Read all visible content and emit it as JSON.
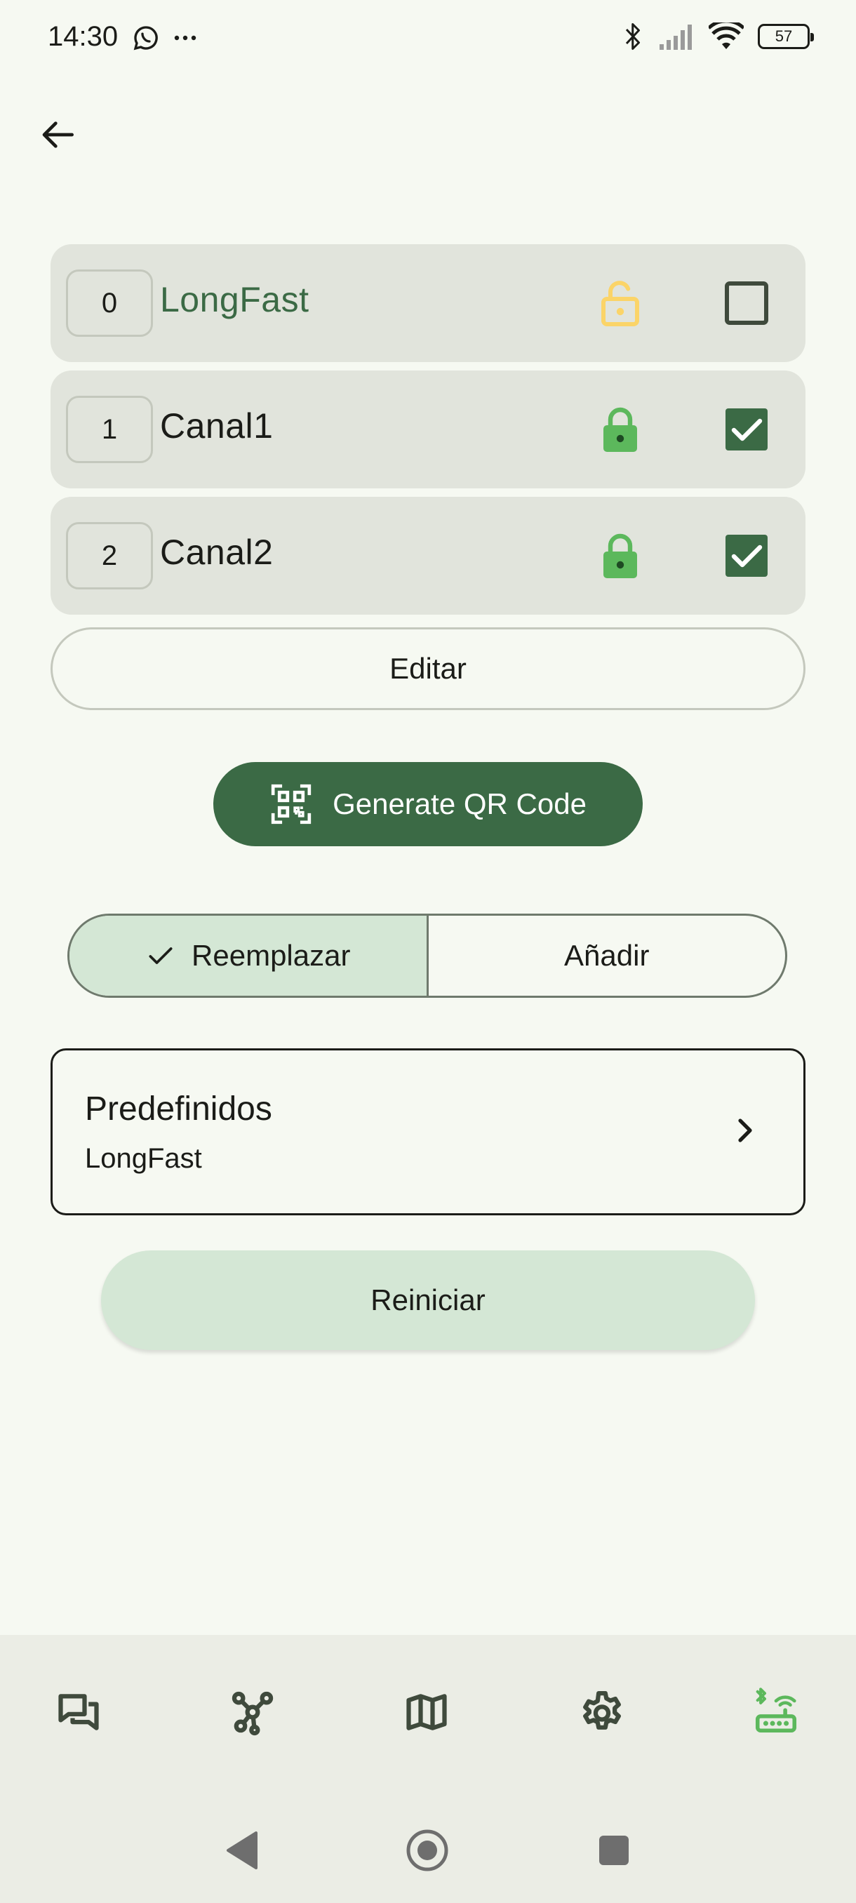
{
  "status_bar": {
    "time": "14:30",
    "battery": "57",
    "icons": [
      "whatsapp-icon",
      "more-dots-icon",
      "bluetooth-icon",
      "signal-icon",
      "wifi-icon",
      "battery-icon"
    ]
  },
  "channels": [
    {
      "index": "0",
      "name": "LongFast",
      "lock": "unlocked",
      "checked": false,
      "name_color": "#3b6a45",
      "lock_color": "#fbd468"
    },
    {
      "index": "1",
      "name": "Canal1",
      "lock": "locked",
      "checked": true,
      "name_color": "#1b1c18",
      "lock_color": "#5cb85c"
    },
    {
      "index": "2",
      "name": "Canal2",
      "lock": "locked",
      "checked": true,
      "name_color": "#1b1c18",
      "lock_color": "#5cb85c"
    }
  ],
  "edit_label": "Editar",
  "qr_label": "Generate QR Code",
  "mode": {
    "replace_label": "Reemplazar",
    "add_label": "Añadir",
    "selected": "replace"
  },
  "presets": {
    "title": "Predefinidos",
    "value": "LongFast"
  },
  "reset_label": "Reiniciar",
  "bottom_nav": {
    "items": [
      "messages-icon",
      "nodes-icon",
      "map-icon",
      "settings-icon",
      "connection-icon"
    ],
    "active": "connection-icon"
  },
  "colors": {
    "background": "#f6f9f2",
    "primary": "#3b6a45",
    "primary_container": "#d4e7d5",
    "row_background": "#e1e4dc",
    "accent_green": "#5cb85c"
  }
}
